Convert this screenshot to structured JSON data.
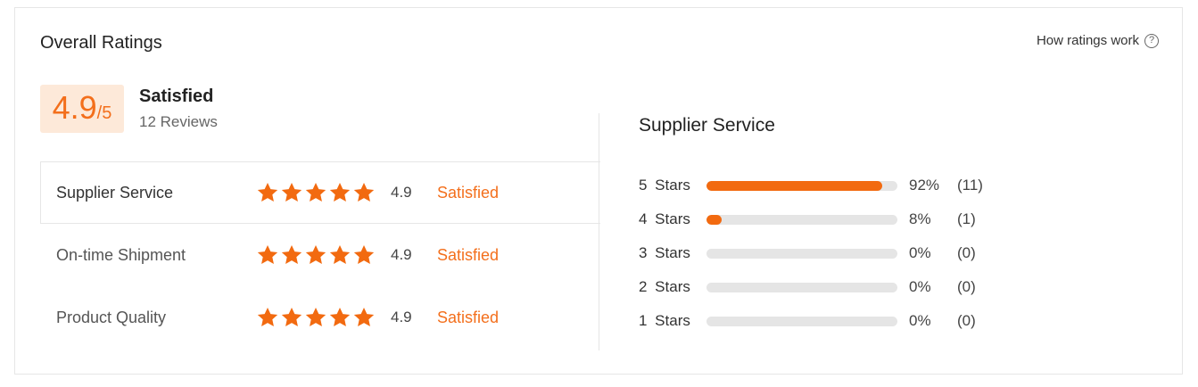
{
  "header": {
    "title": "Overall Ratings",
    "help_label": "How ratings work",
    "help_icon": "question-circle-icon"
  },
  "summary": {
    "score": "4.9",
    "score_separator": "/",
    "score_max": "5",
    "label": "Satisfied",
    "reviews": "12 Reviews"
  },
  "categories": [
    {
      "label": "Supplier Service",
      "score": "4.9",
      "status": "Satisfied",
      "stars": 5
    },
    {
      "label": "On-time Shipment",
      "score": "4.9",
      "status": "Satisfied",
      "stars": 5
    },
    {
      "label": "Product Quality",
      "score": "4.9",
      "status": "Satisfied",
      "stars": 5
    }
  ],
  "detail": {
    "title": "Supplier Service",
    "distribution": [
      {
        "label": "5 Stars",
        "fraction": 0.92,
        "percent": "92%",
        "count": "(11)"
      },
      {
        "label": "4 Stars",
        "fraction": 0.08,
        "percent": "8%",
        "count": "(1)"
      },
      {
        "label": "3 Stars",
        "fraction": 0,
        "percent": "0%",
        "count": "(0)"
      },
      {
        "label": "2 Stars",
        "fraction": 0,
        "percent": "0%",
        "count": "(0)"
      },
      {
        "label": "1 Stars",
        "fraction": 0,
        "percent": "0%",
        "count": "(0)"
      }
    ]
  },
  "colors": {
    "accent": "#f36f1c",
    "star": "#f26a10",
    "score_bg": "#fde9d9",
    "bar_track": "#e5e5e5",
    "bar_fill": "#f26a10"
  }
}
